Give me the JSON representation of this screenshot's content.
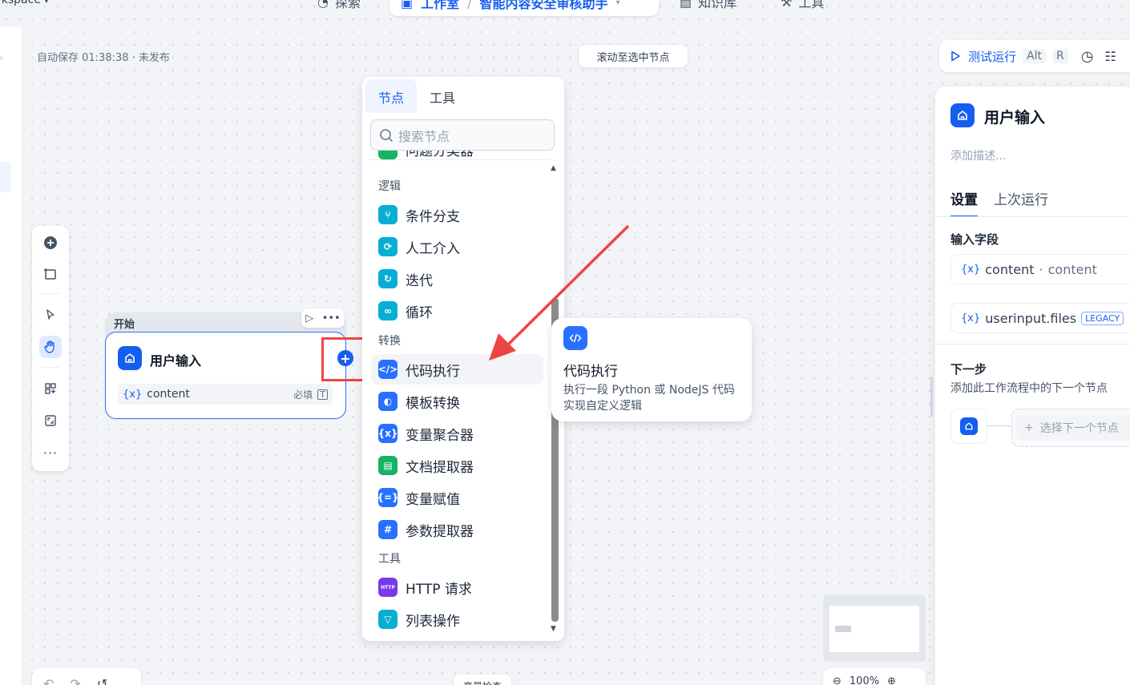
{
  "topbar": {
    "workspace": "rkspace",
    "nav": {
      "explore": "探索",
      "studio": "工作室",
      "app_name": "智能内容安全审核助手",
      "knowledge": "知识库",
      "tools": "工具"
    }
  },
  "canvas": {
    "autosave": "自动保存 01:38:38 · 未发布",
    "scroll_to_selected": "滚动至选中节点",
    "bottom_mid": "变量检查",
    "zoom": "100%"
  },
  "start_node": {
    "group_label": "开始",
    "title": "用户输入",
    "variable": {
      "vx": "{x}",
      "name": "content",
      "required": "必填"
    }
  },
  "picker": {
    "tabs": [
      "节点",
      "工具"
    ],
    "search_placeholder": "搜索节点",
    "cut_item": "问题分类器",
    "categories": {
      "logic": "逻辑",
      "transform": "转换",
      "tools": "工具"
    },
    "items": [
      {
        "label": "条件分支",
        "icon": "branch-icon",
        "color": "#06aed4"
      },
      {
        "label": "人工介入",
        "icon": "human-icon",
        "color": "#06aed4"
      },
      {
        "label": "迭代",
        "icon": "iteration-icon",
        "color": "#06aed4"
      },
      {
        "label": "循环",
        "icon": "loop-icon",
        "color": "#06aed4"
      },
      {
        "label": "代码执行",
        "icon": "code-icon",
        "color": "#2970ff"
      },
      {
        "label": "模板转换",
        "icon": "template-icon",
        "color": "#2970ff"
      },
      {
        "label": "变量聚合器",
        "icon": "variable-aggregator-icon",
        "color": "#2970ff"
      },
      {
        "label": "文档提取器",
        "icon": "doc-extractor-icon",
        "color": "#16b364"
      },
      {
        "label": "变量赋值",
        "icon": "variable-assign-icon",
        "color": "#2970ff"
      },
      {
        "label": "参数提取器",
        "icon": "param-extractor-icon",
        "color": "#2970ff"
      },
      {
        "label": "HTTP 请求",
        "icon": "http-icon",
        "color": "#7839ee"
      },
      {
        "label": "列表操作",
        "icon": "list-operator-icon",
        "color": "#06aed4"
      }
    ]
  },
  "tooltip": {
    "title": "代码执行",
    "description": "执行一段 Python 或 NodeJS 代码实现自定义逻辑"
  },
  "run_bar": {
    "label": "测试运行",
    "kbd1": "Alt",
    "kbd2": "R"
  },
  "panel": {
    "title": "用户输入",
    "description_placeholder": "添加描述...",
    "tabs": [
      "设置",
      "上次运行"
    ],
    "input_fields_title": "输入字段",
    "fields": [
      {
        "vx": "{x}",
        "name": "content",
        "label": "content"
      },
      {
        "vx": "{x}",
        "name": "userinput.files",
        "badge": "LEGACY"
      }
    ],
    "next_step_title": "下一步",
    "next_step_desc": "添加此工作流程中的下一个节点",
    "select_next": "选择下一个节点"
  },
  "colors": {
    "accent": "#155eef",
    "highlight": "#ef4444"
  }
}
